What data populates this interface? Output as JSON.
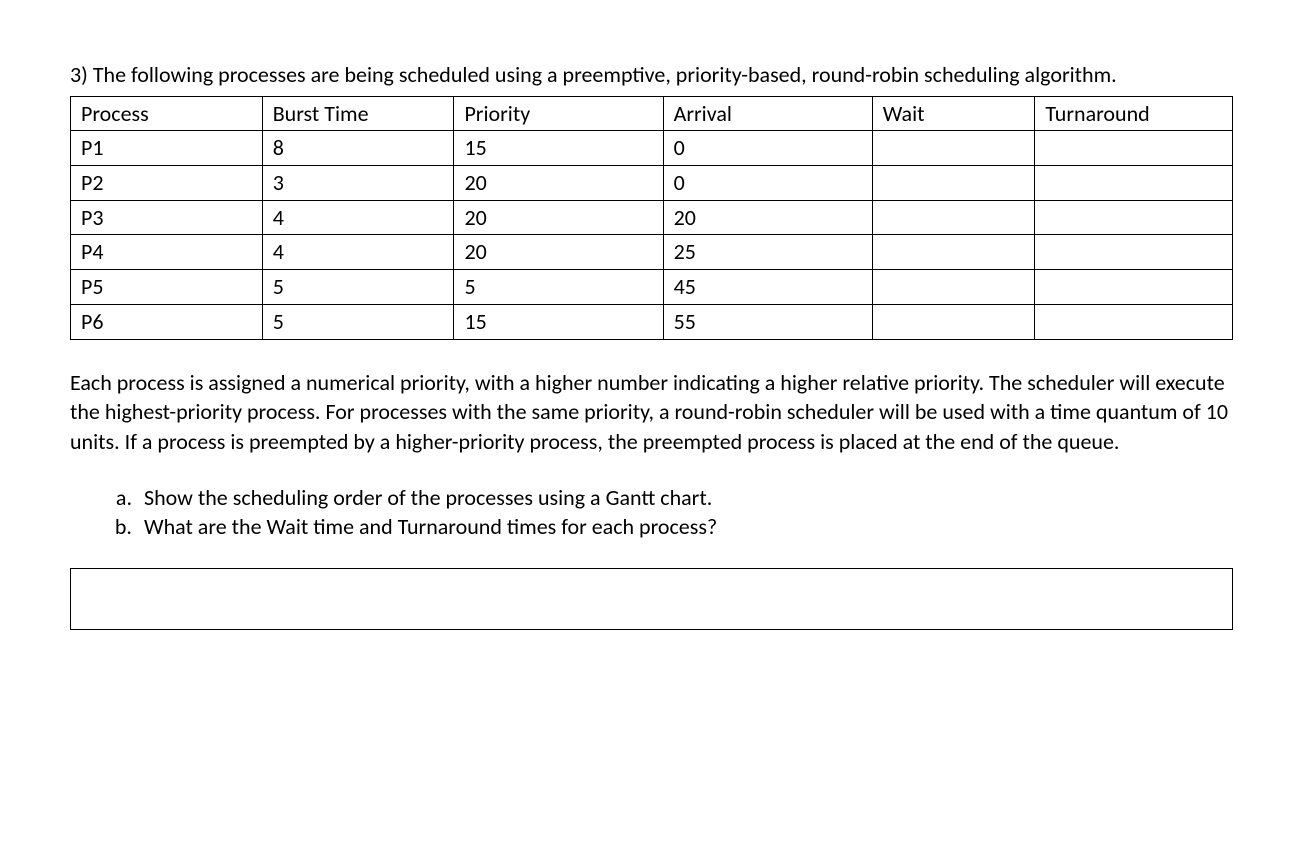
{
  "question": {
    "number": "3)",
    "intro": "The following processes are being scheduled using a preemptive, priority-based, round-robin scheduling algorithm."
  },
  "table": {
    "headers": {
      "process": "Process",
      "burst": "Burst Time",
      "priority": "Priority",
      "arrival": "Arrival",
      "wait": "Wait",
      "turnaround": "Turnaround"
    },
    "rows": [
      {
        "process": "P1",
        "burst": "8",
        "priority": "15",
        "arrival": "0",
        "wait": "",
        "turnaround": ""
      },
      {
        "process": "P2",
        "burst": "3",
        "priority": "20",
        "arrival": "0",
        "wait": "",
        "turnaround": ""
      },
      {
        "process": "P3",
        "burst": "4",
        "priority": "20",
        "arrival": "20",
        "wait": "",
        "turnaround": ""
      },
      {
        "process": "P4",
        "burst": "4",
        "priority": "20",
        "arrival": "25",
        "wait": "",
        "turnaround": ""
      },
      {
        "process": "P5",
        "burst": "5",
        "priority": "5",
        "arrival": "45",
        "wait": "",
        "turnaround": ""
      },
      {
        "process": "P6",
        "burst": "5",
        "priority": "15",
        "arrival": "55",
        "wait": "",
        "turnaround": ""
      }
    ]
  },
  "description": "Each process is assigned a numerical priority, with a higher number indicating a higher relative priority. The scheduler will execute the highest-priority process. For processes with the same priority, a round-robin scheduler will be used with a time quantum of 10 units. If a process is preempted by a higher-priority process, the preempted process is placed at the end of the queue.",
  "subquestions": [
    {
      "label": "a.",
      "text": "Show the scheduling order of the processes using a Gantt chart."
    },
    {
      "label": "b.",
      "text": "What are the Wait time and Turnaround times for each process?"
    }
  ]
}
